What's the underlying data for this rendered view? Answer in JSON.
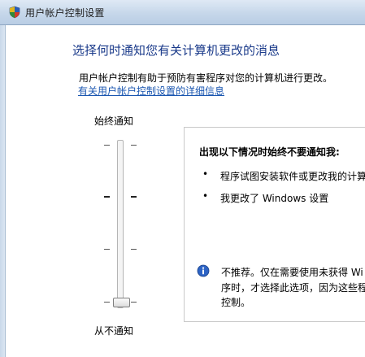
{
  "window": {
    "title": "用户帐户控制设置",
    "heading": "选择何时通知您有关计算机更改的消息",
    "description": "用户帐户控制有助于预防有害程序对您的计算机进行更改。",
    "link_text": "有关用户帐户控制设置的详细信息"
  },
  "slider": {
    "top_label": "始终通知",
    "bottom_label": "从不通知",
    "levels": 4,
    "selected_level": 1
  },
  "panel": {
    "heading": "出现以下情况时始终不要通知我:",
    "bullets": [
      "程序试图安装软件或更改我的计算",
      "我更改了 Windows 设置"
    ],
    "note_lines": [
      "不推荐。仅在需要使用未获得 Wi",
      "序时，才选择此选项，因为这些程",
      "控制。"
    ]
  },
  "icons": {
    "title": "uac-shield-icon",
    "note": "info-icon"
  },
  "colors": {
    "heading": "#1a3a8a",
    "link": "#1a56b0"
  }
}
